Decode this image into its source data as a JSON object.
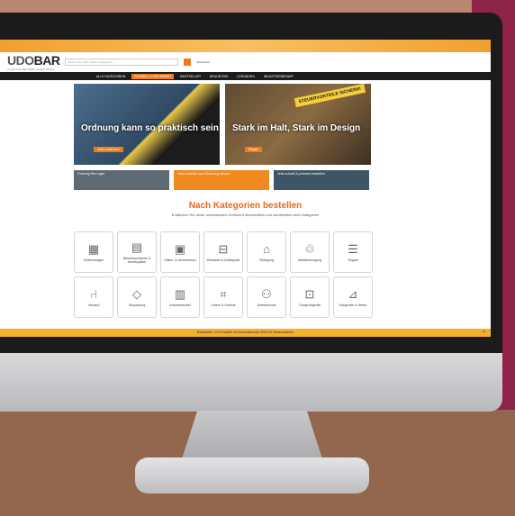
{
  "site": {
    "logo_primary": "UDO",
    "logo_secondary": "BAR",
    "logo_tag": "ALLES FÜR BETRIEB, LAGER, BÜRO",
    "search_placeholder": "Suchen Sie nach Artikeln, Kategorien...",
    "header_link": "Warenkorb",
    "nav": [
      "ALLE KATEGORIEN",
      "SCHNELL & PREISWERT",
      "BESTSELLER",
      "NEUHEITEN",
      "LÖSUNGEN",
      "INDUSTRIEBEDARF"
    ]
  },
  "hero": {
    "banner1_title": "Ordnung kann so praktisch sein",
    "banner1_cta": "Jetzt entdecken",
    "banner2_title": "Stark im Halt, Stark im Design",
    "banner2_cta": "Regale",
    "banner2_badge": "STEUERVORTEILE SICHERN!"
  },
  "subbanners": [
    "Ordnung fürs Lager",
    "Jetzt bestellen und Förderung sichern",
    "Jetzt schnell & preiswert bestellen"
  ],
  "categories_section": {
    "title": "Nach Kategorien bestellen",
    "subtitle": "Entdecken Sie unser umfassendes Sortiment übersichtlich und komfortabel nach Kategorien"
  },
  "categories": [
    {
      "icon": "cabinet-icon",
      "glyph": "▦",
      "label": "Sortieranlagen"
    },
    {
      "icon": "shelf-icon",
      "glyph": "▤",
      "label": "Betriebsschränke & Arbeitsplätze"
    },
    {
      "icon": "garage-icon",
      "glyph": "▣",
      "label": "Hallen- & Gewerbebau"
    },
    {
      "icon": "workbench-icon",
      "glyph": "⊟",
      "label": "Werkstatt & Arbeitsplatz"
    },
    {
      "icon": "cleaning-icon",
      "glyph": "⌂",
      "label": "Reinigung"
    },
    {
      "icon": "waste-icon",
      "glyph": "♲",
      "label": "Abfallentsorgung"
    },
    {
      "icon": "rack-icon",
      "glyph": "☰",
      "label": "Regale"
    },
    {
      "icon": "chair-icon",
      "glyph": "⑁",
      "label": "Versand"
    },
    {
      "icon": "box-icon",
      "glyph": "◇",
      "label": "Verpackung"
    },
    {
      "icon": "barrel-icon",
      "glyph": "▥",
      "label": "Industriebedarf"
    },
    {
      "icon": "ladder-icon",
      "glyph": "⌗",
      "label": "Leitern & Gerüste"
    },
    {
      "icon": "safety-icon",
      "glyph": "⚇",
      "label": "Arbeitsschutz"
    },
    {
      "icon": "cart-icon",
      "glyph": "⊡",
      "label": "Transportgeräte"
    },
    {
      "icon": "lift-icon",
      "glyph": "⊿",
      "label": "Hubgeräte & Heben"
    }
  ],
  "cookie_bar": "Newsletter? 10% Rabatt* mit Gutscheincode UB10 für Neukundinnen"
}
